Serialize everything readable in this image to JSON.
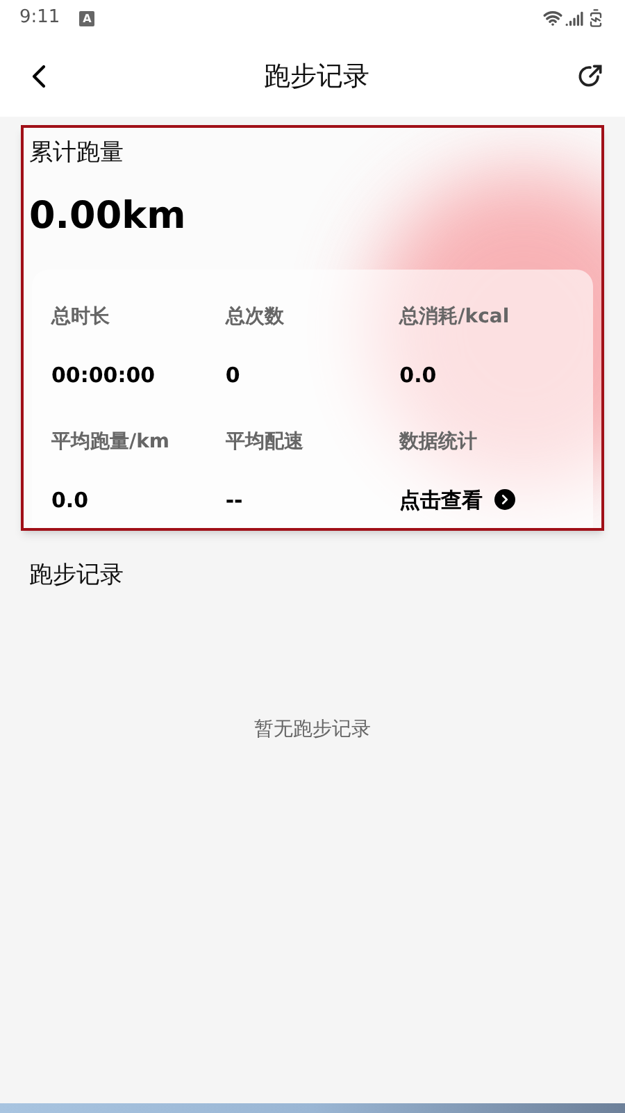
{
  "status_bar": {
    "time": "9:11",
    "notification": "A"
  },
  "header": {
    "title": "跑步记录"
  },
  "summary": {
    "title": "累计跑量",
    "total": "0.00km",
    "highlighted": true,
    "stats": [
      {
        "label": "总时长",
        "value": "00:00:00",
        "kind": "text"
      },
      {
        "label": "总次数",
        "value": "0",
        "kind": "text"
      },
      {
        "label": "总消耗/kcal",
        "value": "0.0",
        "kind": "text"
      },
      {
        "label": "平均跑量/km",
        "value": "0.0",
        "kind": "text"
      },
      {
        "label": "平均配速",
        "value": "--",
        "kind": "text"
      },
      {
        "label": "数据统计",
        "value": "点击查看",
        "kind": "link"
      }
    ]
  },
  "records": {
    "title": "跑步记录",
    "empty_text": "暂无跑步记录"
  }
}
